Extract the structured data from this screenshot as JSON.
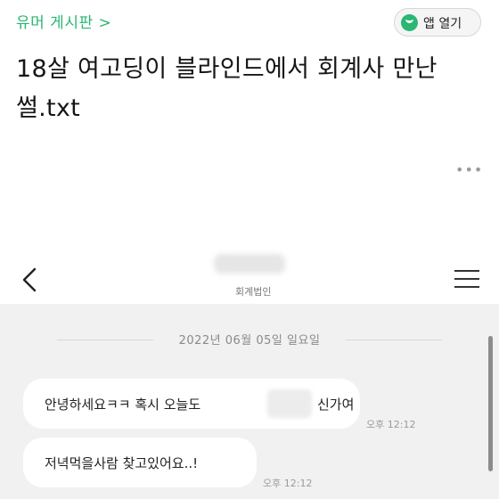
{
  "post": {
    "board_link": "유머 게시판 >",
    "open_app_label": "앱 열기",
    "title": "18살 여고딩이 블라인드에서 회계사 만난 썰.txt",
    "more_icon": "more-dots-icon"
  },
  "chat": {
    "org_label": "회계법인",
    "date_separator": "2022년 06월 05일 일요일",
    "messages": [
      {
        "text_before": "안녕하세요ㅋㅋ 혹시 오늘도",
        "text_after": "신가여",
        "time": "오후 12:12"
      },
      {
        "text_before": "저녁먹을사람 찾고있어요..!",
        "text_after": "",
        "time": "오후 12:12"
      }
    ]
  },
  "colors": {
    "brand_green": "#2bb673",
    "chat_background": "#f1f1f1",
    "bubble": "#ffffff"
  }
}
